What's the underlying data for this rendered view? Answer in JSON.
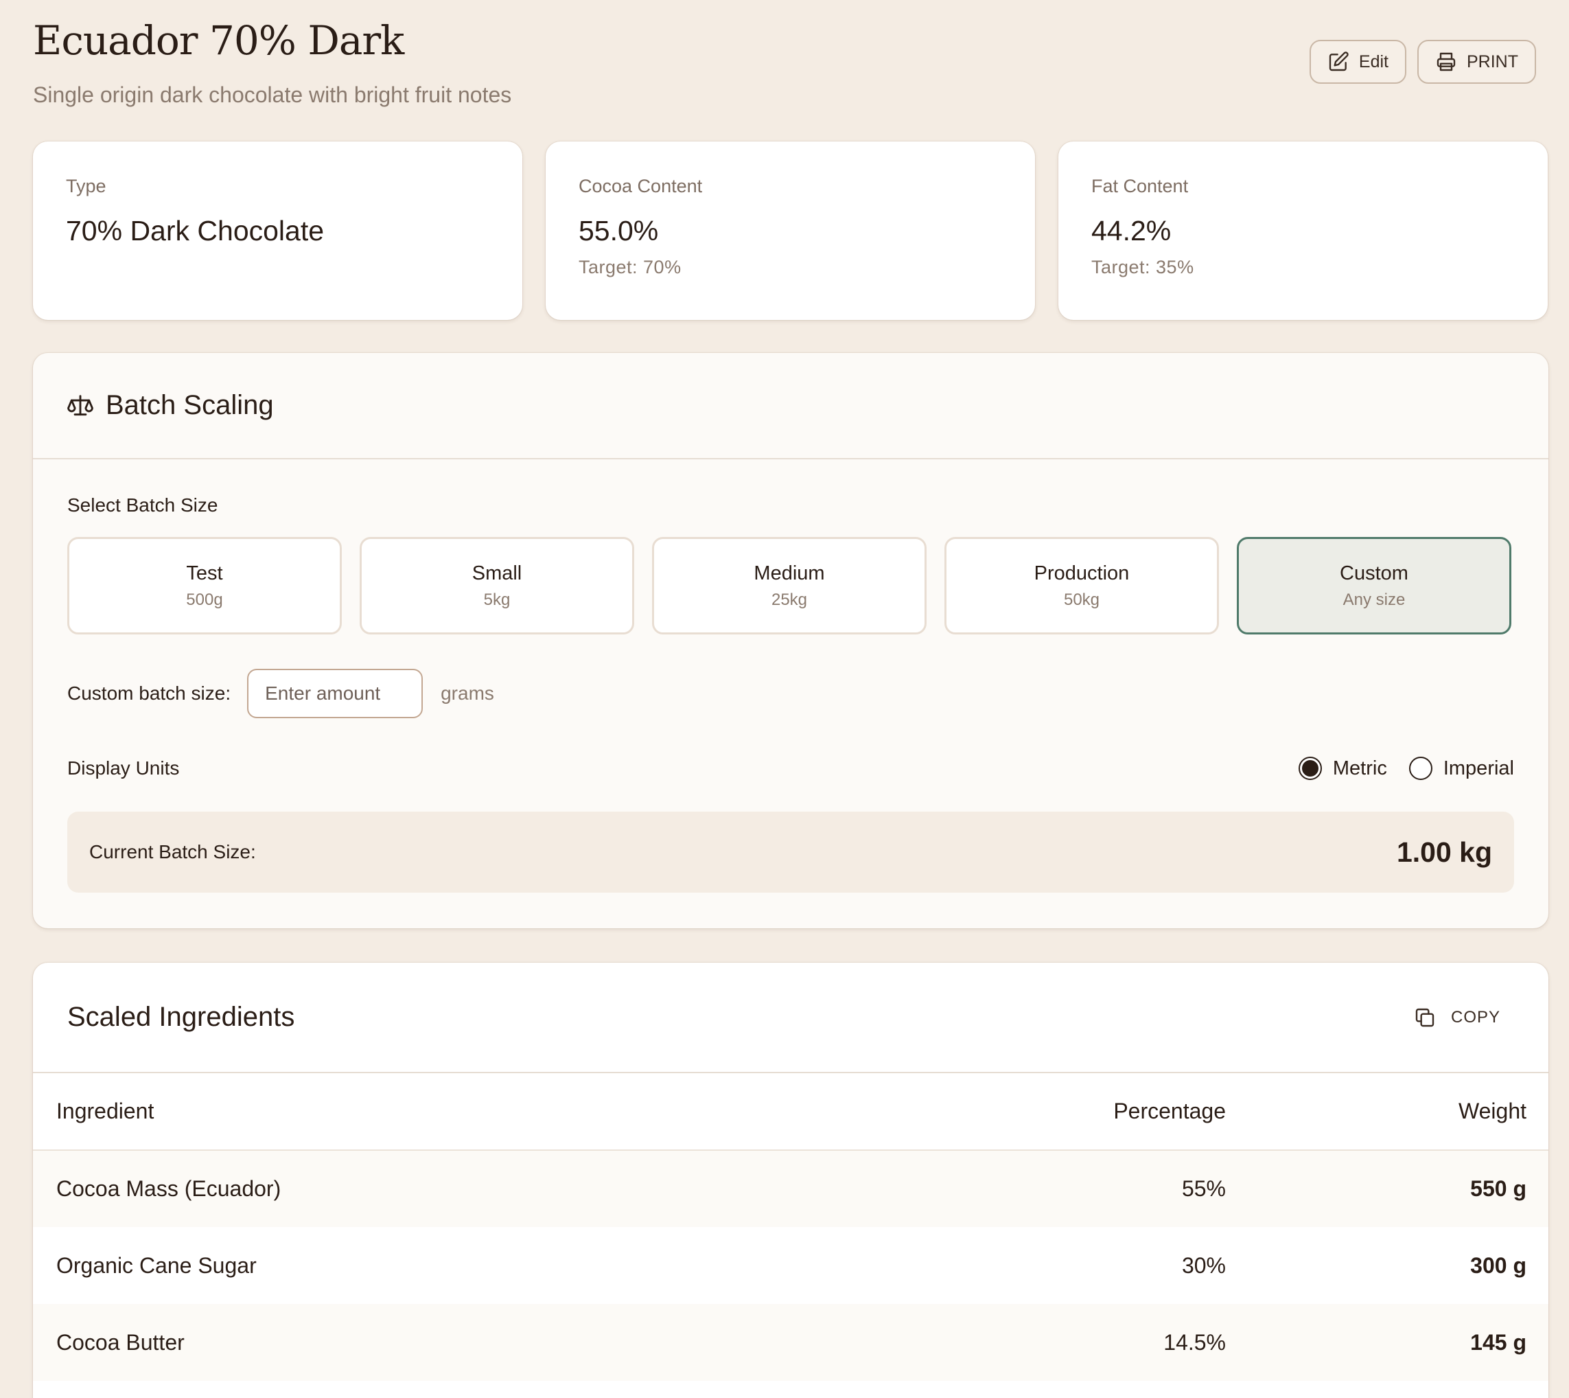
{
  "header": {
    "title": "Ecuador 70% Dark",
    "subtitle": "Single origin dark chocolate with bright fruit notes",
    "edit_label": "Edit",
    "print_label": "PRINT"
  },
  "stats": {
    "type_label": "Type",
    "type_value": "70% Dark Chocolate",
    "cocoa_label": "Cocoa Content",
    "cocoa_value": "55.0%",
    "cocoa_target": "Target: 70%",
    "fat_label": "Fat Content",
    "fat_value": "44.2%",
    "fat_target": "Target: 35%"
  },
  "batch": {
    "title": "Batch Scaling",
    "select_label": "Select Batch Size",
    "sizes": [
      {
        "name": "Test",
        "sub": "500g"
      },
      {
        "name": "Small",
        "sub": "5kg"
      },
      {
        "name": "Medium",
        "sub": "25kg"
      },
      {
        "name": "Production",
        "sub": "50kg"
      },
      {
        "name": "Custom",
        "sub": "Any size"
      }
    ],
    "selected_size": "Custom",
    "custom_label": "Custom batch size:",
    "custom_placeholder": "Enter amount",
    "custom_unit": "grams",
    "units_label": "Display Units",
    "unit_metric": "Metric",
    "unit_imperial": "Imperial",
    "selected_unit": "Metric",
    "current_label": "Current Batch Size:",
    "current_value": "1.00 kg"
  },
  "ingredients": {
    "title": "Scaled Ingredients",
    "copy_label": "COPY",
    "columns": [
      "Ingredient",
      "Percentage",
      "Weight"
    ],
    "rows": [
      {
        "name": "Cocoa Mass (Ecuador)",
        "pct": "55%",
        "weight": "550 g"
      },
      {
        "name": "Organic Cane Sugar",
        "pct": "30%",
        "weight": "300 g"
      },
      {
        "name": "Cocoa Butter",
        "pct": "14.5%",
        "weight": "145 g"
      }
    ]
  },
  "icons": {
    "edit": "edit-icon",
    "print": "printer-icon",
    "scale": "scale-icon",
    "copy": "copy-icon"
  },
  "colors": {
    "background": "#f4ece3",
    "accent_selected": "#4f7a6a",
    "text": "#2a1d16"
  }
}
